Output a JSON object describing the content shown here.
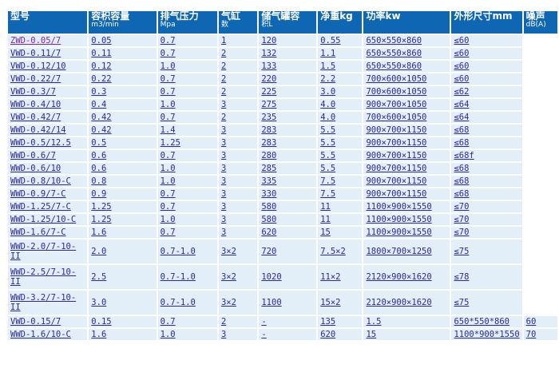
{
  "headers": [
    {
      "main": "型号",
      "sub": ""
    },
    {
      "main": "容积容量",
      "sub": "m3/min"
    },
    {
      "main": "排气压力",
      "sub": "Mpa"
    },
    {
      "main": "气缸",
      "sub": "数"
    },
    {
      "main": "储气罐容",
      "sub": "积L"
    },
    {
      "main": "净重kg",
      "sub": ""
    },
    {
      "main": "功率kw",
      "sub": ""
    },
    {
      "main": "外形尺寸mm",
      "sub": ""
    },
    {
      "main": "噪声",
      "sub": "dB(A)"
    }
  ],
  "rows": [
    {
      "cells": [
        "ZWD-0.05/7",
        "0.05",
        "0.7",
        "1",
        "120",
        "0.55",
        "650×550×860",
        "≤60",
        ""
      ]
    },
    {
      "cells": [
        "VWD-0.11/7",
        "0.11",
        "0.7",
        "2",
        "132",
        "1.1",
        "650×550×860",
        "≤60",
        ""
      ]
    },
    {
      "cells": [
        "VWD-0.12/10",
        "0.12",
        "1.0",
        "2",
        "133",
        "1.5",
        "650×550×860",
        "≤60",
        ""
      ]
    },
    {
      "cells": [
        "VWD-0.22/7",
        "0.22",
        "0.7",
        "2",
        "220",
        "2.2",
        "700×600×1050",
        "≤60",
        ""
      ]
    },
    {
      "cells": [
        "VWD-0.3/7",
        "0.3",
        "0.7",
        "2",
        "225",
        "3.0",
        "700×600×1050",
        "≤62",
        ""
      ]
    },
    {
      "cells": [
        "WWD-0.4/10",
        "0.4",
        "1.0",
        "3",
        "275",
        "4.0",
        "900×700×1050",
        "≤64",
        ""
      ]
    },
    {
      "cells": [
        "VWD-0.42/7",
        "0.42",
        "0.7",
        "2",
        "235",
        "4.0",
        "700×600×1050",
        "≤64",
        ""
      ]
    },
    {
      "cells": [
        "WWD-0.42/14",
        "0.42",
        "1.4",
        "3",
        "283",
        "5.5",
        "900×700×1150",
        "≤68",
        ""
      ]
    },
    {
      "cells": [
        "WWD-0.5/12.5",
        "0.5",
        "1.25",
        "3",
        "283",
        "5.5",
        "900×700×1150",
        "≤68",
        ""
      ]
    },
    {
      "cells": [
        "WWD-0.6/7",
        "0.6",
        "0.7",
        "3",
        "280",
        "5.5",
        "900×700×1150",
        "≤68f",
        ""
      ]
    },
    {
      "cells": [
        "WWD-0.6/10",
        "0.6",
        "1.0",
        "3",
        "285",
        "5.5",
        "900×700×1150",
        "≤68",
        ""
      ]
    },
    {
      "cells": [
        "WWD-0.8/10-C",
        "0.8",
        "1.0",
        "3",
        "335",
        "7.5",
        "900×700×1150",
        "≤68",
        ""
      ]
    },
    {
      "cells": [
        "WWD-0.9/7-C",
        "0.9",
        "0.7",
        "3",
        "330",
        "7.5",
        "900×700×1150",
        "≤68",
        ""
      ]
    },
    {
      "cells": [
        "WWD-1.25/7-C",
        "1.25",
        "0.7",
        "3",
        "580",
        "11",
        "1100×900×1550",
        "≤70",
        ""
      ]
    },
    {
      "cells": [
        "WWD-1.25/10-C",
        "1.25",
        "1.0",
        "3",
        "580",
        "11",
        "1100×900×1550",
        "≤70",
        ""
      ]
    },
    {
      "cells": [
        "WWD-1.6/7-C",
        "1.6",
        "0.7",
        "3",
        "620",
        "15",
        "1100×900×1550",
        "≤70",
        ""
      ]
    },
    {
      "tall": true,
      "cells": [
        "WWD-2.0/7-10-II",
        "2.0",
        "0.7-1.0",
        "3×2",
        "720",
        "7.5×2",
        "1800×700×1250",
        "≤75",
        ""
      ]
    },
    {
      "tall": true,
      "cells": [
        "WWD-2.5/7-10-II",
        "2.5",
        "0.7-1.0",
        "3×2",
        "1020",
        "11×2",
        "2120×900×1620",
        "≤78",
        ""
      ]
    },
    {
      "tall": true,
      "cells": [
        "WWD-3.2/7-10-II",
        "3.0",
        "0.7-1.0",
        "3×2",
        "1100",
        "15×2",
        "2120×900×1620",
        "≤75",
        ""
      ]
    },
    {
      "cells": [
        "VWD-0.15/7",
        "0.15",
        "0.7",
        "2",
        "-",
        "135",
        "1.5",
        "650*550*860",
        "60"
      ]
    },
    {
      "cells": [
        "WWD-1.6/10-C",
        "1.6",
        "1.0",
        "3",
        "-",
        "620",
        "15",
        "1100*900*1550",
        "70"
      ]
    }
  ]
}
